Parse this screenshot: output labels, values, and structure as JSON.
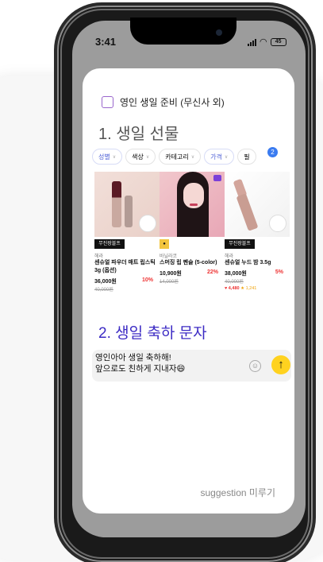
{
  "status": {
    "time": "3:41",
    "battery": "45"
  },
  "todo": {
    "label": "영인 생일 준비 (무신사 외)"
  },
  "section1": {
    "title": "1. 생일 선물"
  },
  "filters": [
    {
      "label": "성별"
    },
    {
      "label": "색상"
    },
    {
      "label": "카테고리"
    },
    {
      "label": "가격"
    },
    {
      "label": "필"
    }
  ],
  "filter_badge": "2",
  "products": [
    {
      "tag": "무진장블프",
      "brand": "헤라",
      "name": "센슈얼 파우더 매트 립스틱 3g (옵션)",
      "price": "36,000원",
      "discount": "10%",
      "old_price": "40,000원"
    },
    {
      "tag": "",
      "brand": "바닐라코",
      "name": "스머징 립 펜슬 (5-color)",
      "price": "10,900원",
      "discount": "22%",
      "old_price": "14,000원"
    },
    {
      "tag": "무진장블프",
      "brand": "헤라",
      "name": "센슈얼 누드 밤 3.5g",
      "price": "38,000원",
      "discount": "5%",
      "old_price": "40,000원",
      "likes": "4,480",
      "reviews": "1,241"
    }
  ],
  "section2": {
    "title": "2. 생일 축하 문자"
  },
  "message": {
    "text": "영인아아 생일 축하해!\n앞으로도 친하게 지내자😄"
  },
  "suggestion": {
    "label": "suggestion 미루기"
  }
}
